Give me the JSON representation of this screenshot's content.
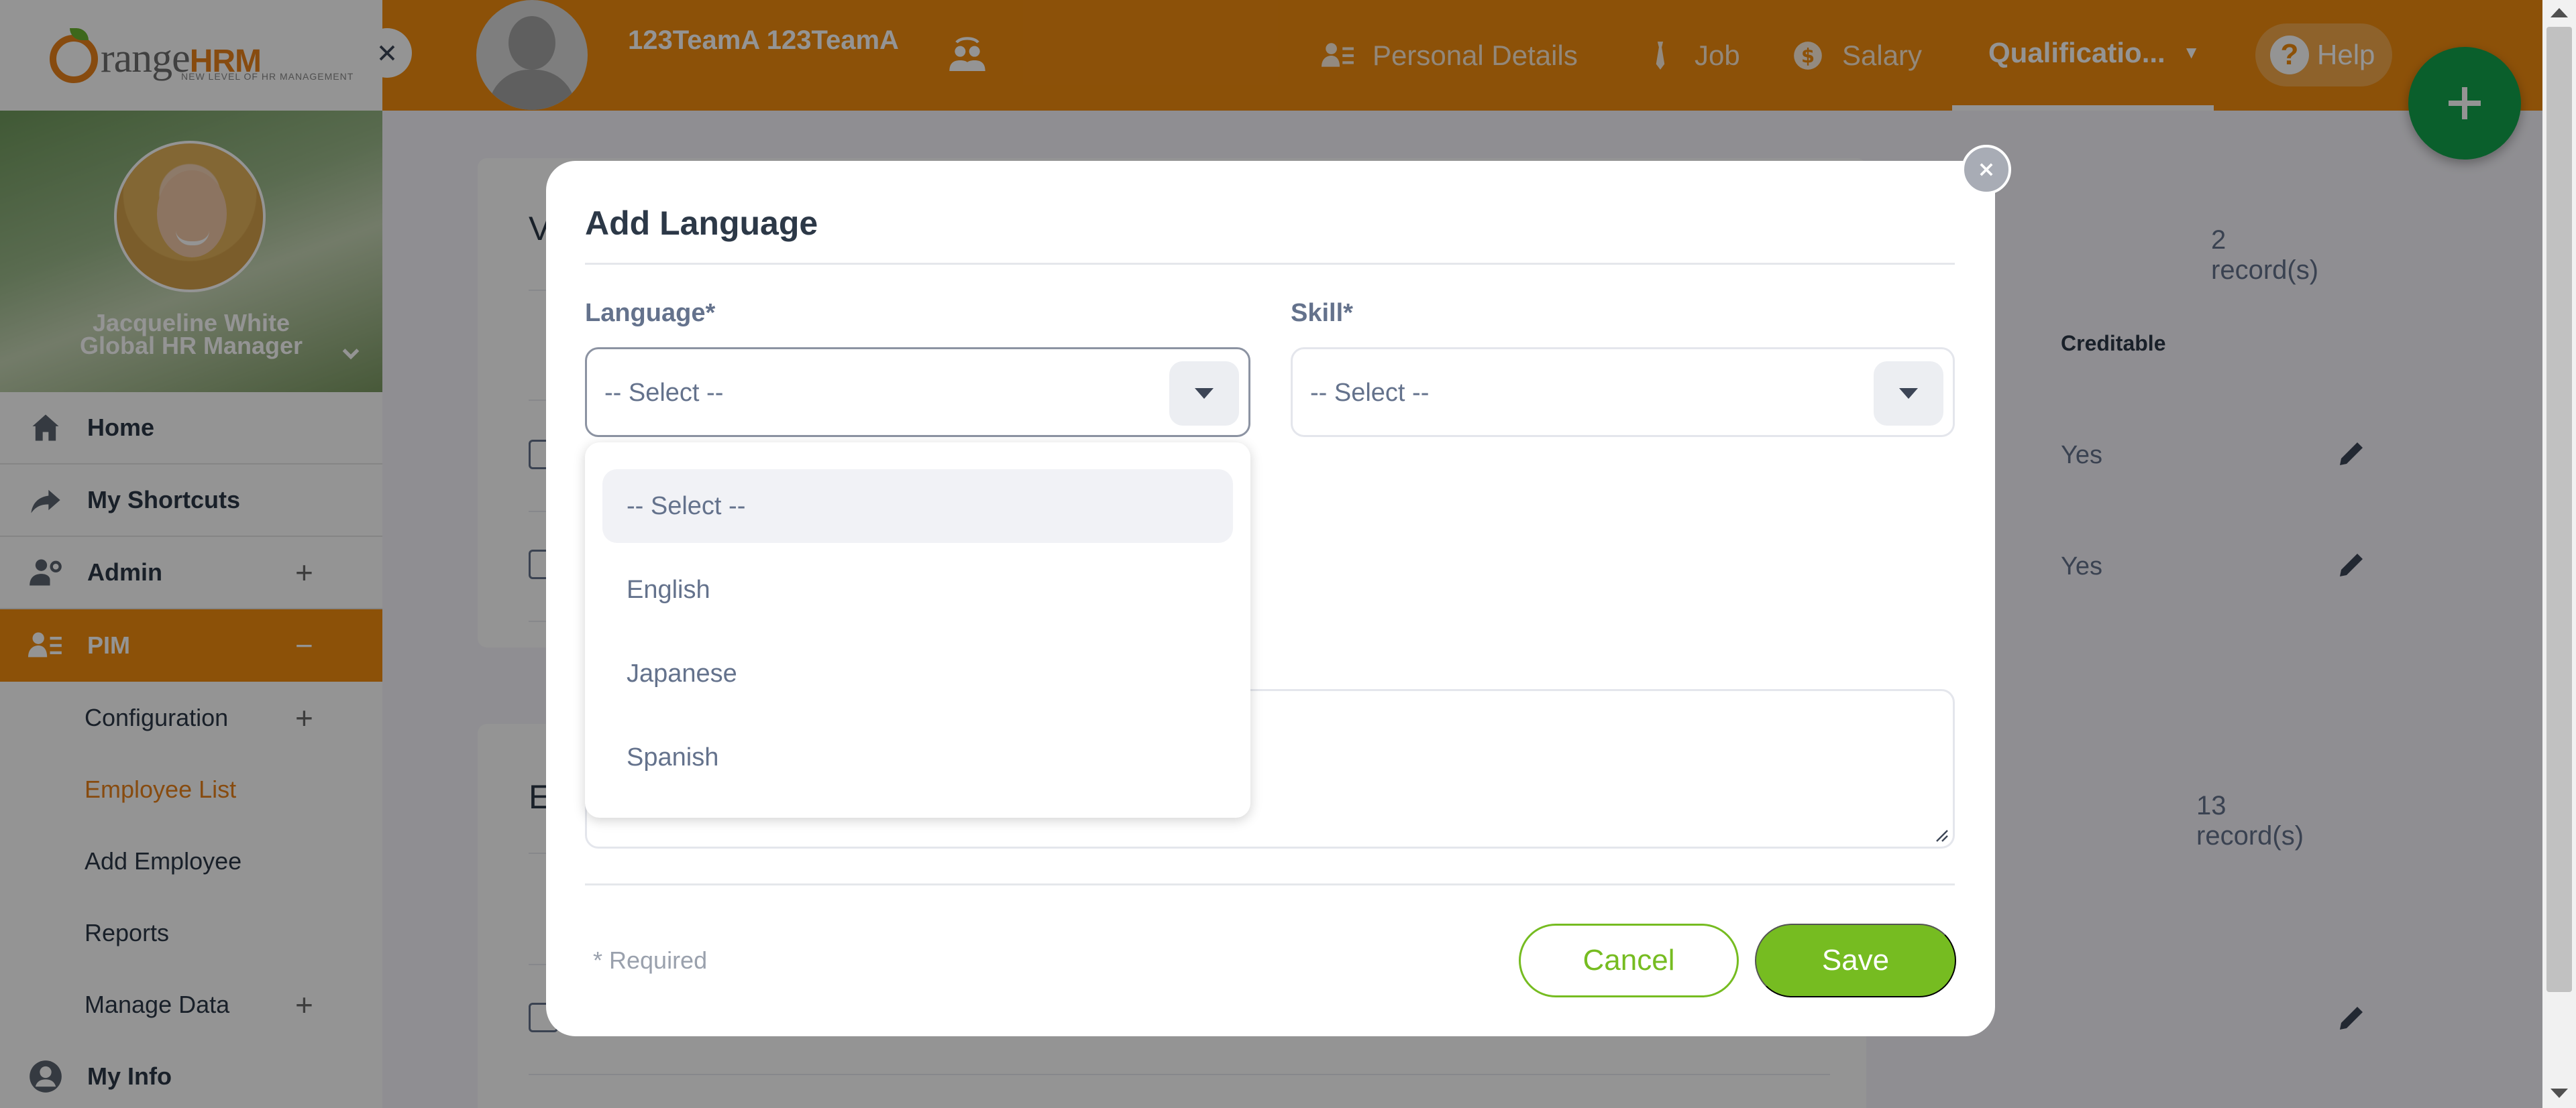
{
  "brand": {
    "name_main": "range",
    "name_accent": "HRM",
    "tagline": "NEW LEVEL OF HR MANAGEMENT"
  },
  "user": {
    "name": "Jacqueline White",
    "role": "Global HR Manager"
  },
  "sidebar": {
    "items": [
      {
        "label": "Home"
      },
      {
        "label": "My Shortcuts"
      },
      {
        "label": "Admin",
        "toggle": "+"
      },
      {
        "label": "PIM",
        "toggle": "−"
      }
    ],
    "pim_sub": [
      {
        "label": "Configuration",
        "toggle": "+"
      },
      {
        "label": "Employee List"
      },
      {
        "label": "Add Employee"
      },
      {
        "label": "Reports"
      },
      {
        "label": "Manage Data",
        "toggle": "+"
      }
    ],
    "my_info": "My Info"
  },
  "topbar": {
    "employee_name": "123TeamA 123TeamA",
    "tabs": [
      {
        "label": "Personal Details"
      },
      {
        "label": "Job"
      },
      {
        "label": "Salary"
      },
      {
        "label": "Qualificatio..."
      }
    ],
    "help": "Help"
  },
  "background": {
    "section1_initial": "V",
    "section1_count": "2 record(s)",
    "col_creditable": "Creditable",
    "row1_creditable": "Yes",
    "row2_creditable": "Yes",
    "section2_initial": "E",
    "section2_count": "13 record(s)"
  },
  "modal": {
    "title": "Add Language",
    "language_label": "Language*",
    "language_value": "-- Select --",
    "skill_label": "Skill*",
    "skill_value": "-- Select --",
    "dropdown_options": [
      "-- Select --",
      "English",
      "Japanese",
      "Spanish"
    ],
    "required_note": "* Required",
    "cancel": "Cancel",
    "save": "Save"
  },
  "colors": {
    "accent": "#f28c0f",
    "success": "#76bc21",
    "fab": "#12a44c"
  }
}
